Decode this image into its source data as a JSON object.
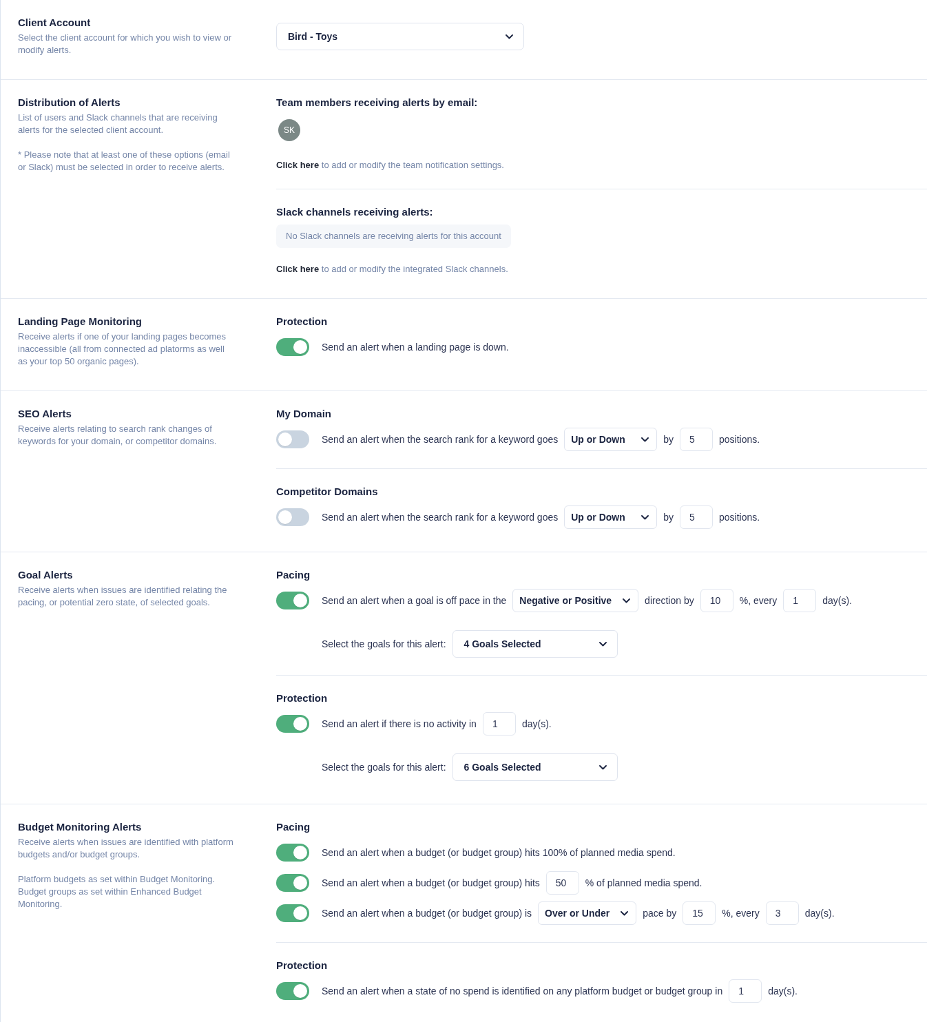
{
  "sections": [
    {
      "kind": "account",
      "title": "Client Account",
      "description": [
        "Select the client account for which you wish to view or modify alerts."
      ],
      "select": {
        "value": "Bird - Toys"
      }
    },
    {
      "kind": "distribution",
      "title": "Distribution of Alerts",
      "description": [
        "List of users and Slack channels that are receiving alerts for the selected client account.",
        "* Please note that at least one of these options (email or Slack) must be selected in order to receive alerts."
      ],
      "groups": [
        {
          "heading": "Team members receiving alerts by email:",
          "avatars": [
            "SK"
          ],
          "link": "Click here",
          "link_note": "to add or modify the team notification settings."
        },
        {
          "heading": "Slack channels receiving alerts:",
          "empty_message": "No Slack channels are receiving alerts for this account",
          "link": "Click here",
          "link_note": "to add or modify the integrated Slack channels."
        }
      ]
    },
    {
      "kind": "alerts",
      "title": "Landing Page Monitoring",
      "description": [
        "Receive alerts if one of your landing pages becomes inaccessible (all from connected ad platorms as well as your top 50 organic pages)."
      ],
      "groups": [
        {
          "heading": "Protection",
          "rows": [
            {
              "kind": "toggle",
              "on": true,
              "parts": [
                {
                  "kind": "text",
                  "text": "Send an alert when a landing page is down."
                }
              ]
            }
          ]
        }
      ]
    },
    {
      "kind": "alerts",
      "title": "SEO Alerts",
      "description": [
        "Receive alerts relating to search rank changes of keywords for your domain, or competitor domains."
      ],
      "groups": [
        {
          "heading": "My Domain",
          "rows": [
            {
              "kind": "toggle",
              "on": false,
              "parts": [
                {
                  "kind": "text",
                  "text": "Send an alert when the search rank for a keyword goes"
                },
                {
                  "kind": "select",
                  "value": "Up or Down"
                },
                {
                  "kind": "text",
                  "text": "by"
                },
                {
                  "kind": "input",
                  "value": "5"
                },
                {
                  "kind": "text",
                  "text": "positions."
                }
              ]
            }
          ]
        },
        {
          "heading": "Competitor Domains",
          "rows": [
            {
              "kind": "toggle",
              "on": false,
              "parts": [
                {
                  "kind": "text",
                  "text": "Send an alert when the search rank for a keyword goes"
                },
                {
                  "kind": "select",
                  "value": "Up or Down"
                },
                {
                  "kind": "text",
                  "text": "by"
                },
                {
                  "kind": "input",
                  "value": "5"
                },
                {
                  "kind": "text",
                  "text": "positions."
                }
              ]
            }
          ]
        }
      ]
    },
    {
      "kind": "alerts",
      "title": "Goal Alerts",
      "description": [
        "Receive alerts when issues are identified relating the pacing, or potential zero state, of selected goals."
      ],
      "groups": [
        {
          "heading": "Pacing",
          "rows": [
            {
              "kind": "toggle",
              "on": true,
              "parts": [
                {
                  "kind": "text",
                  "text": "Send an alert when a goal is off pace in the"
                },
                {
                  "kind": "select",
                  "value": "Negative or Positive"
                },
                {
                  "kind": "text",
                  "text": "direction by"
                },
                {
                  "kind": "input",
                  "value": "10"
                },
                {
                  "kind": "text",
                  "text": "%, every"
                },
                {
                  "kind": "input",
                  "value": "1"
                },
                {
                  "kind": "text",
                  "text": "day(s)."
                }
              ]
            },
            {
              "kind": "plain",
              "parts": [
                {
                  "kind": "text",
                  "text": "Select the goals for this alert:"
                },
                {
                  "kind": "select",
                  "value": "4 Goals Selected"
                }
              ]
            }
          ]
        },
        {
          "heading": "Protection",
          "rows": [
            {
              "kind": "toggle",
              "on": true,
              "parts": [
                {
                  "kind": "text",
                  "text": "Send an alert if there is no activity in"
                },
                {
                  "kind": "input",
                  "value": "1"
                },
                {
                  "kind": "text",
                  "text": "day(s)."
                }
              ]
            },
            {
              "kind": "plain",
              "parts": [
                {
                  "kind": "text",
                  "text": "Select the goals for this alert:"
                },
                {
                  "kind": "select",
                  "value": "6 Goals Selected"
                }
              ]
            }
          ]
        }
      ]
    },
    {
      "kind": "alerts",
      "title": "Budget Monitoring Alerts",
      "description": [
        "Receive alerts when issues are identified with platform budgets and/or budget groups.",
        "Platform budgets as set within Budget Monitoring. Budget groups as set within Enhanced Budget Monitoring."
      ],
      "groups": [
        {
          "heading": "Pacing",
          "rows": [
            {
              "kind": "toggle",
              "on": true,
              "parts": [
                {
                  "kind": "text",
                  "text": "Send an alert when a budget (or budget group) hits 100% of planned media spend."
                }
              ]
            },
            {
              "kind": "toggle",
              "on": true,
              "parts": [
                {
                  "kind": "text",
                  "text": "Send an alert when a budget (or budget group) hits"
                },
                {
                  "kind": "input",
                  "value": "50"
                },
                {
                  "kind": "text",
                  "text": "% of planned media spend."
                }
              ]
            },
            {
              "kind": "toggle",
              "on": true,
              "parts": [
                {
                  "kind": "text",
                  "text": "Send an alert when a budget (or budget group) is"
                },
                {
                  "kind": "select",
                  "value": "Over or Under"
                },
                {
                  "kind": "text",
                  "text": "pace by"
                },
                {
                  "kind": "input",
                  "value": "15"
                },
                {
                  "kind": "text",
                  "text": "%, every"
                },
                {
                  "kind": "input",
                  "value": "3"
                },
                {
                  "kind": "text",
                  "text": "day(s)."
                }
              ]
            }
          ]
        },
        {
          "heading": "Protection",
          "rows": [
            {
              "kind": "toggle",
              "on": true,
              "parts": [
                {
                  "kind": "text",
                  "text": "Send an alert when a state of no spend is identified on any platform budget or budget group in"
                },
                {
                  "kind": "input",
                  "value": "1"
                },
                {
                  "kind": "text",
                  "text": "day(s)."
                }
              ]
            }
          ]
        }
      ]
    }
  ]
}
